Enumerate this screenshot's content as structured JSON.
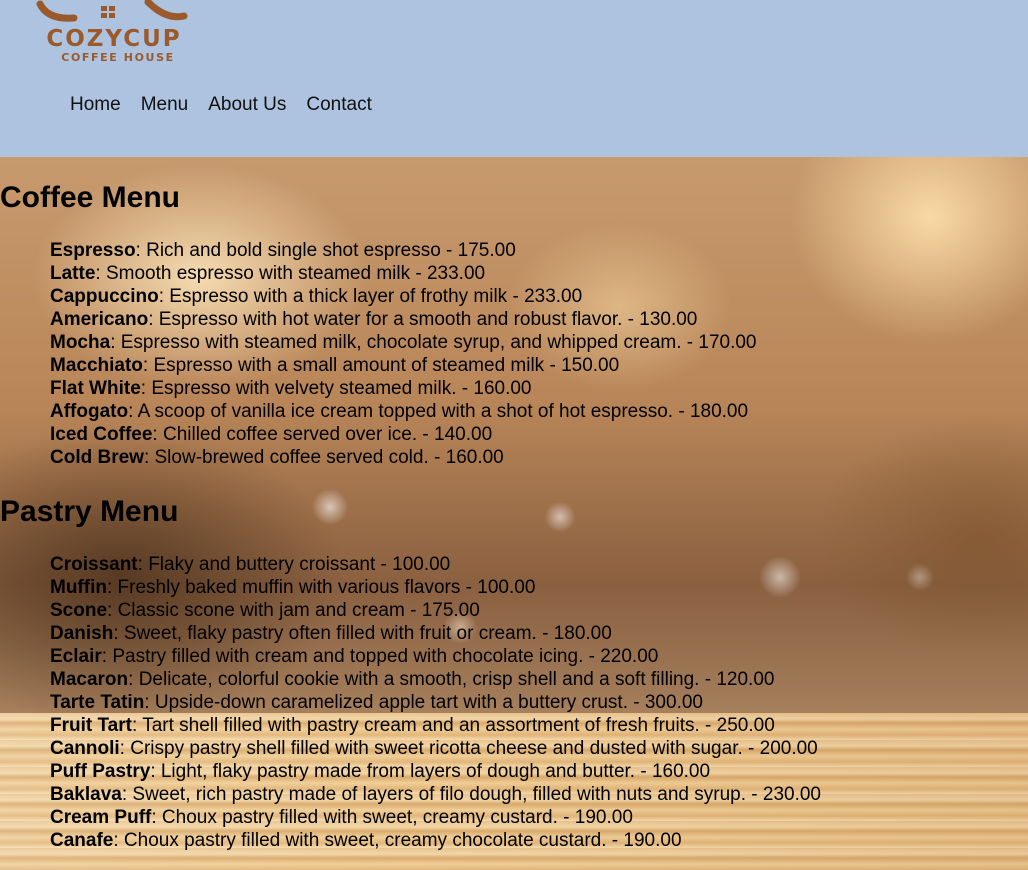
{
  "header": {
    "logo_name": "COZYCUP",
    "logo_subtitle": "COFFEE HOUSE"
  },
  "nav": {
    "items": [
      "Home",
      "Menu",
      "About Us",
      "Contact"
    ]
  },
  "colors": {
    "header_bg": "#adc3e0",
    "logo_brown": "#9a5a2c"
  },
  "coffee_menu": {
    "title": "Coffee Menu",
    "items": [
      {
        "name": "Espresso",
        "desc": ": Rich and bold single shot espresso - 175.00"
      },
      {
        "name": "Latte",
        "desc": ": Smooth espresso with steamed milk - 233.00"
      },
      {
        "name": "Cappuccino",
        "desc": ": Espresso with a thick layer of frothy milk - 233.00"
      },
      {
        "name": "Americano",
        "desc": ": Espresso with hot water for a smooth and robust flavor. - 130.00"
      },
      {
        "name": "Mocha",
        "desc": ": Espresso with steamed milk, chocolate syrup, and whipped cream. - 170.00"
      },
      {
        "name": "Macchiato",
        "desc": ": Espresso with a small amount of steamed milk - 150.00"
      },
      {
        "name": "Flat White",
        "desc": ": Espresso with velvety steamed milk. - 160.00"
      },
      {
        "name": "Affogato",
        "desc": ": A scoop of vanilla ice cream topped with a shot of hot espresso. - 180.00"
      },
      {
        "name": "Iced Coffee",
        "desc": ": Chilled coffee served over ice. - 140.00"
      },
      {
        "name": "Cold Brew",
        "desc": ": Slow-brewed coffee served cold. - 160.00"
      }
    ]
  },
  "pastry_menu": {
    "title": "Pastry Menu",
    "items": [
      {
        "name": "Croissant",
        "desc": ": Flaky and buttery croissant - 100.00"
      },
      {
        "name": "Muffin",
        "desc": ": Freshly baked muffin with various flavors - 100.00"
      },
      {
        "name": "Scone",
        "desc": ": Classic scone with jam and cream - 175.00"
      },
      {
        "name": "Danish",
        "desc": ": Sweet, flaky pastry often filled with fruit or cream. - 180.00"
      },
      {
        "name": "Eclair",
        "desc": ": Pastry filled with cream and topped with chocolate icing. - 220.00"
      },
      {
        "name": "Macaron",
        "desc": ": Delicate, colorful cookie with a smooth, crisp shell and a soft filling. - 120.00"
      },
      {
        "name": "Tarte Tatin",
        "desc": ": Upside-down caramelized apple tart with a buttery crust. - 300.00"
      },
      {
        "name": "Fruit Tart",
        "desc": ": Tart shell filled with pastry cream and an assortment of fresh fruits. - 250.00"
      },
      {
        "name": "Cannoli",
        "desc": ": Crispy pastry shell filled with sweet ricotta cheese and dusted with sugar. - 200.00"
      },
      {
        "name": "Puff Pastry",
        "desc": ": Light, flaky pastry made from layers of dough and butter. - 160.00"
      },
      {
        "name": "Baklava",
        "desc": ": Sweet, rich pastry made of layers of filo dough, filled with nuts and syrup. - 230.00"
      },
      {
        "name": "Cream Puff",
        "desc": ": Choux pastry filled with sweet, creamy custard. - 190.00"
      },
      {
        "name": "Canafe",
        "desc": ": Choux pastry filled with sweet, creamy chocolate custard. - 190.00"
      }
    ]
  }
}
